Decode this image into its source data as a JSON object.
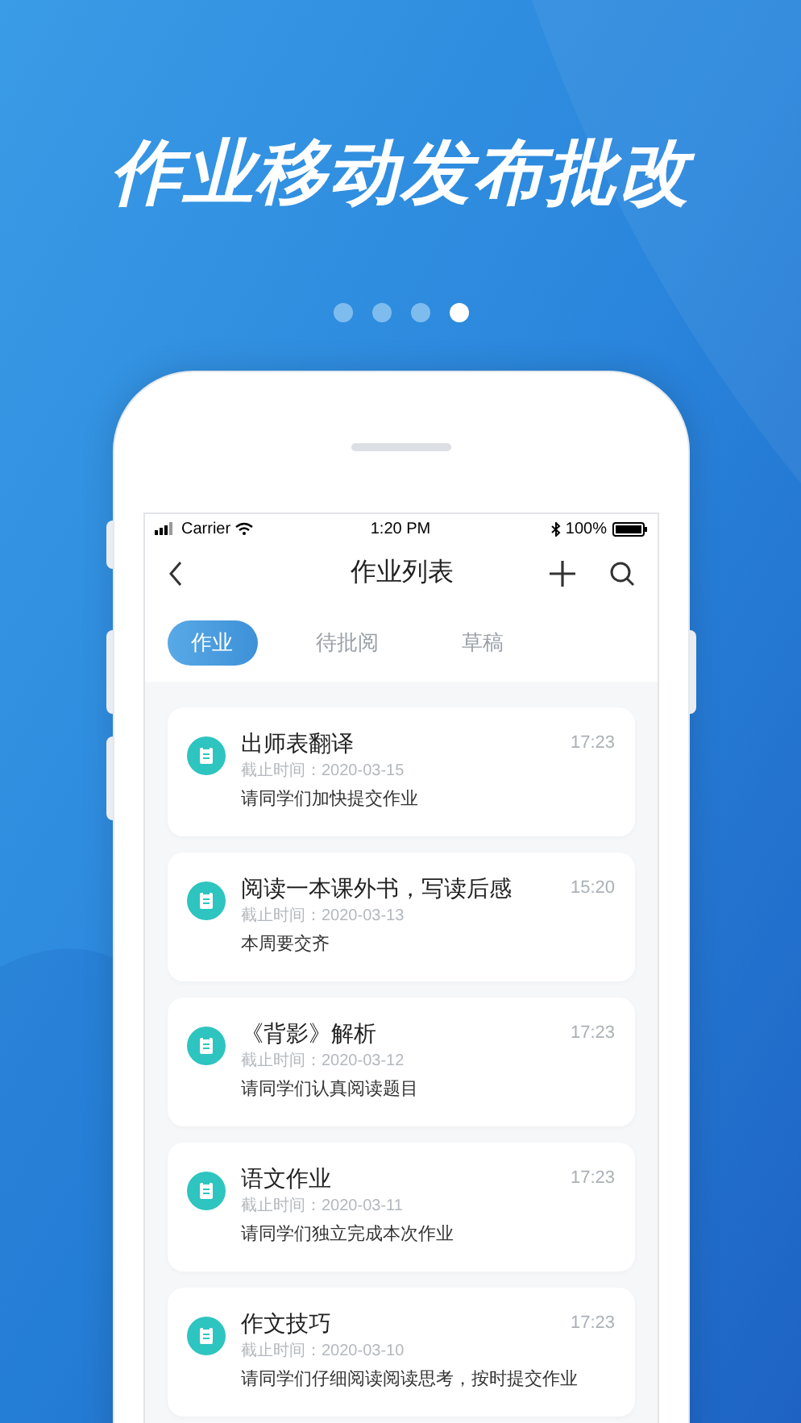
{
  "headline": "作业移动发布批改",
  "pager": [
    {
      "selected": false
    },
    {
      "selected": false
    },
    {
      "selected": false
    },
    {
      "selected": true
    }
  ],
  "status_bar": {
    "carrier": "Carrier",
    "time": "1:20 PM",
    "battery": "100%"
  },
  "nav": {
    "title": "作业列表"
  },
  "tabs": [
    {
      "label": "作业",
      "selected": true
    },
    {
      "label": "待批阅",
      "selected": false
    },
    {
      "label": "草稿",
      "selected": false
    }
  ],
  "assignments": [
    {
      "title": "出师表翻译",
      "time": "17:23",
      "deadline": "截止时间：2020-03-15",
      "note": "请同学们加快提交作业"
    },
    {
      "title": "阅读一本课外书，写读后感",
      "time": "15:20",
      "deadline": "截止时间：2020-03-13",
      "note": "本周要交齐"
    },
    {
      "title": "《背影》解析",
      "time": "17:23",
      "deadline": "截止时间：2020-03-12",
      "note": "请同学们认真阅读题目"
    },
    {
      "title": "语文作业",
      "time": "17:23",
      "deadline": "截止时间：2020-03-11",
      "note": "请同学们独立完成本次作业"
    },
    {
      "title": "作文技巧",
      "time": "17:23",
      "deadline": "截止时间：2020-03-10",
      "note": "请同学们仔细阅读阅读思考，按时提交作业"
    }
  ]
}
